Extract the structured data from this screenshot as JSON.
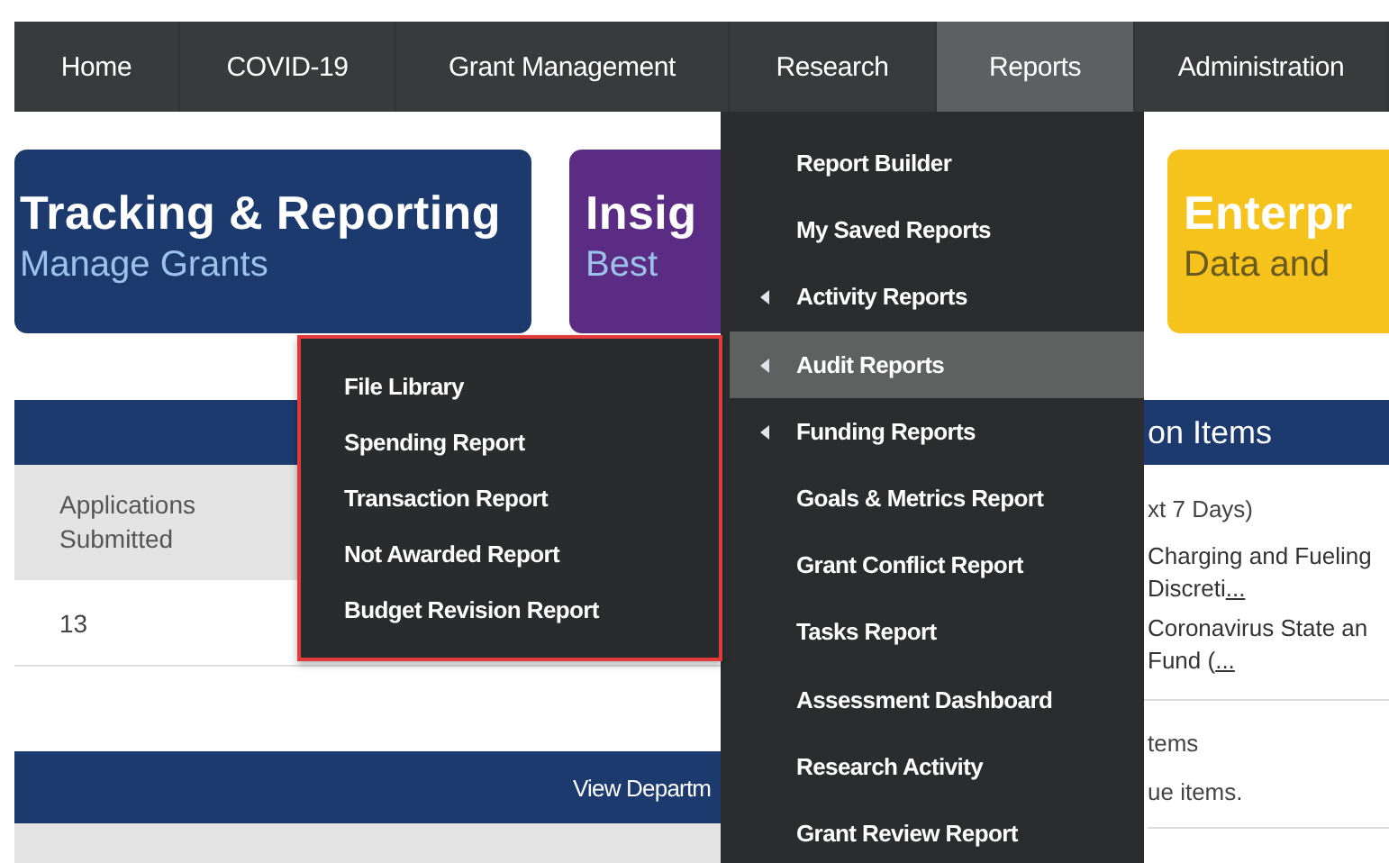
{
  "nav": {
    "items": [
      {
        "label": "Home",
        "selected": false
      },
      {
        "label": "COVID-19",
        "selected": false
      },
      {
        "label": "Grant Management",
        "selected": false
      },
      {
        "label": "Research",
        "selected": false
      },
      {
        "label": "Reports",
        "selected": true
      },
      {
        "label": "Administration",
        "selected": false
      }
    ]
  },
  "tiles": [
    {
      "title": "Tracking & Reporting",
      "subtitle": "Manage Grants",
      "color": "#1d3a6e"
    },
    {
      "title": "Insig",
      "subtitle": "Best",
      "color": "#5b2c83"
    },
    {
      "title": "Enterpr",
      "subtitle": "Data and",
      "color": "#f6c21c"
    }
  ],
  "summary_panel": {
    "column": "Applications Submitted",
    "value": "13"
  },
  "department_panel": {
    "link": "View Departm"
  },
  "action_items_panel": {
    "title": "on Items",
    "heading": "xt 7 Days)",
    "items": [
      {
        "lines": [
          "Charging and Fueling",
          "Discreti"
        ],
        "link": "..."
      },
      {
        "lines": [
          "Coronavirus State an",
          "Fund ("
        ],
        "link": "..."
      }
    ],
    "section_2_heading": "tems",
    "section_2_message": "ue items."
  },
  "reports_menu": {
    "items": [
      {
        "label": "Report Builder",
        "has_submenu": false,
        "selected": false
      },
      {
        "label": "My Saved Reports",
        "has_submenu": false,
        "selected": false
      },
      {
        "label": "Activity Reports",
        "has_submenu": true,
        "selected": false
      },
      {
        "label": "Audit Reports",
        "has_submenu": true,
        "selected": true
      },
      {
        "label": "Funding Reports",
        "has_submenu": true,
        "selected": false
      },
      {
        "label": "Goals & Metrics Report",
        "has_submenu": false,
        "selected": false
      },
      {
        "label": "Grant Conflict Report",
        "has_submenu": false,
        "selected": false
      },
      {
        "label": "Tasks Report",
        "has_submenu": false,
        "selected": false
      },
      {
        "label": "Assessment Dashboard",
        "has_submenu": false,
        "selected": false
      },
      {
        "label": "Research Activity",
        "has_submenu": false,
        "selected": false
      },
      {
        "label": "Grant Review Report",
        "has_submenu": false,
        "selected": false
      }
    ]
  },
  "audit_submenu": {
    "items": [
      {
        "label": "File Library"
      },
      {
        "label": "Spending Report"
      },
      {
        "label": "Transaction Report"
      },
      {
        "label": "Not Awarded Report"
      },
      {
        "label": "Budget Revision Report"
      }
    ]
  }
}
